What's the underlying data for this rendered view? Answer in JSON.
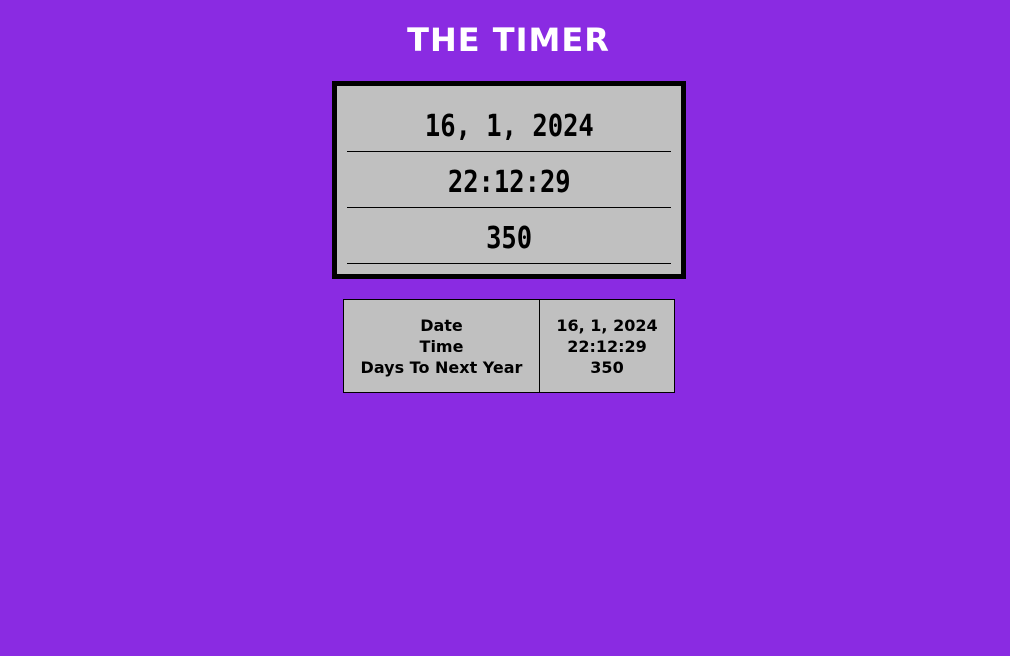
{
  "header": {
    "title": "THE TIMER"
  },
  "display": {
    "date": "16, 1, 2024",
    "time": "22:12:29",
    "days_left": "350"
  },
  "table": {
    "labels": [
      "Date",
      "Time",
      "Days To Next Year"
    ],
    "values": [
      "16, 1, 2024",
      "22:12:29",
      "350"
    ]
  },
  "colors": {
    "background": "#8a2be2",
    "panel": "#c0c0c0",
    "border": "#000000",
    "title_text": "#ffffff"
  }
}
